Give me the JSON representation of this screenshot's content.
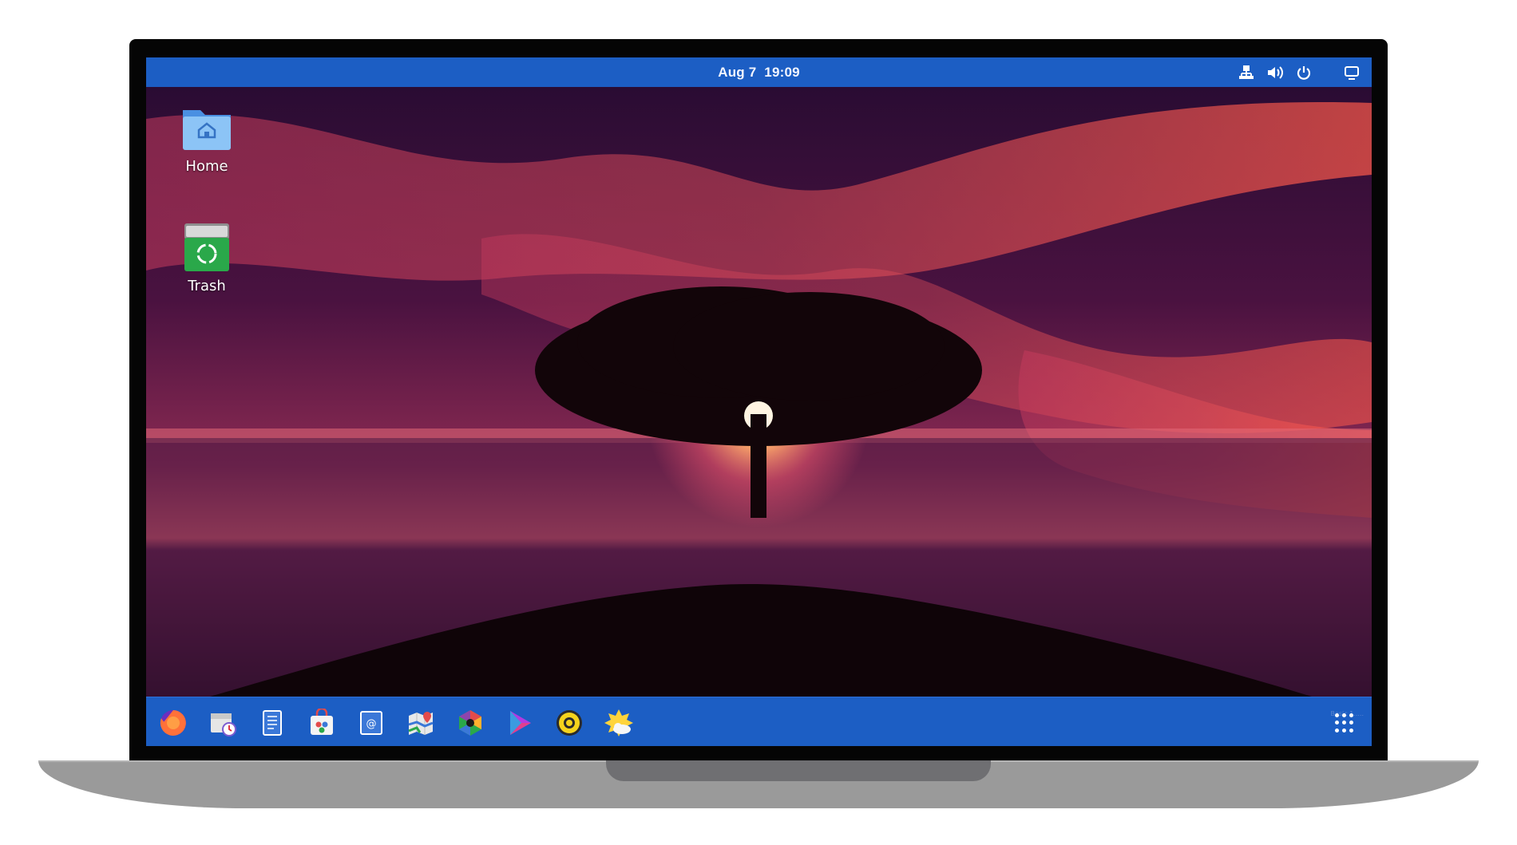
{
  "topbar": {
    "clock": "Aug 7  19:09",
    "icons": [
      "network-icon",
      "volume-icon",
      "power-icon",
      "show-desktop-icon"
    ]
  },
  "desktop": {
    "icons": [
      {
        "label": "Home",
        "icon": "home-folder-icon"
      },
      {
        "label": "Trash",
        "icon": "trash-icon"
      }
    ]
  },
  "dock": {
    "apps": [
      "firefox-icon",
      "calendar-clock-icon",
      "text-editor-icon",
      "software-store-icon",
      "email-client-icon",
      "maps-icon",
      "photos-icon",
      "media-player-icon",
      "music-player-icon",
      "weather-icon"
    ],
    "watermark": "Basic 1.....",
    "app_grid": "app-grid-icon"
  },
  "colors": {
    "panel_blue": "#1c5ec4",
    "laptop_base": "#9a9a9a",
    "bezel": "#050505"
  }
}
